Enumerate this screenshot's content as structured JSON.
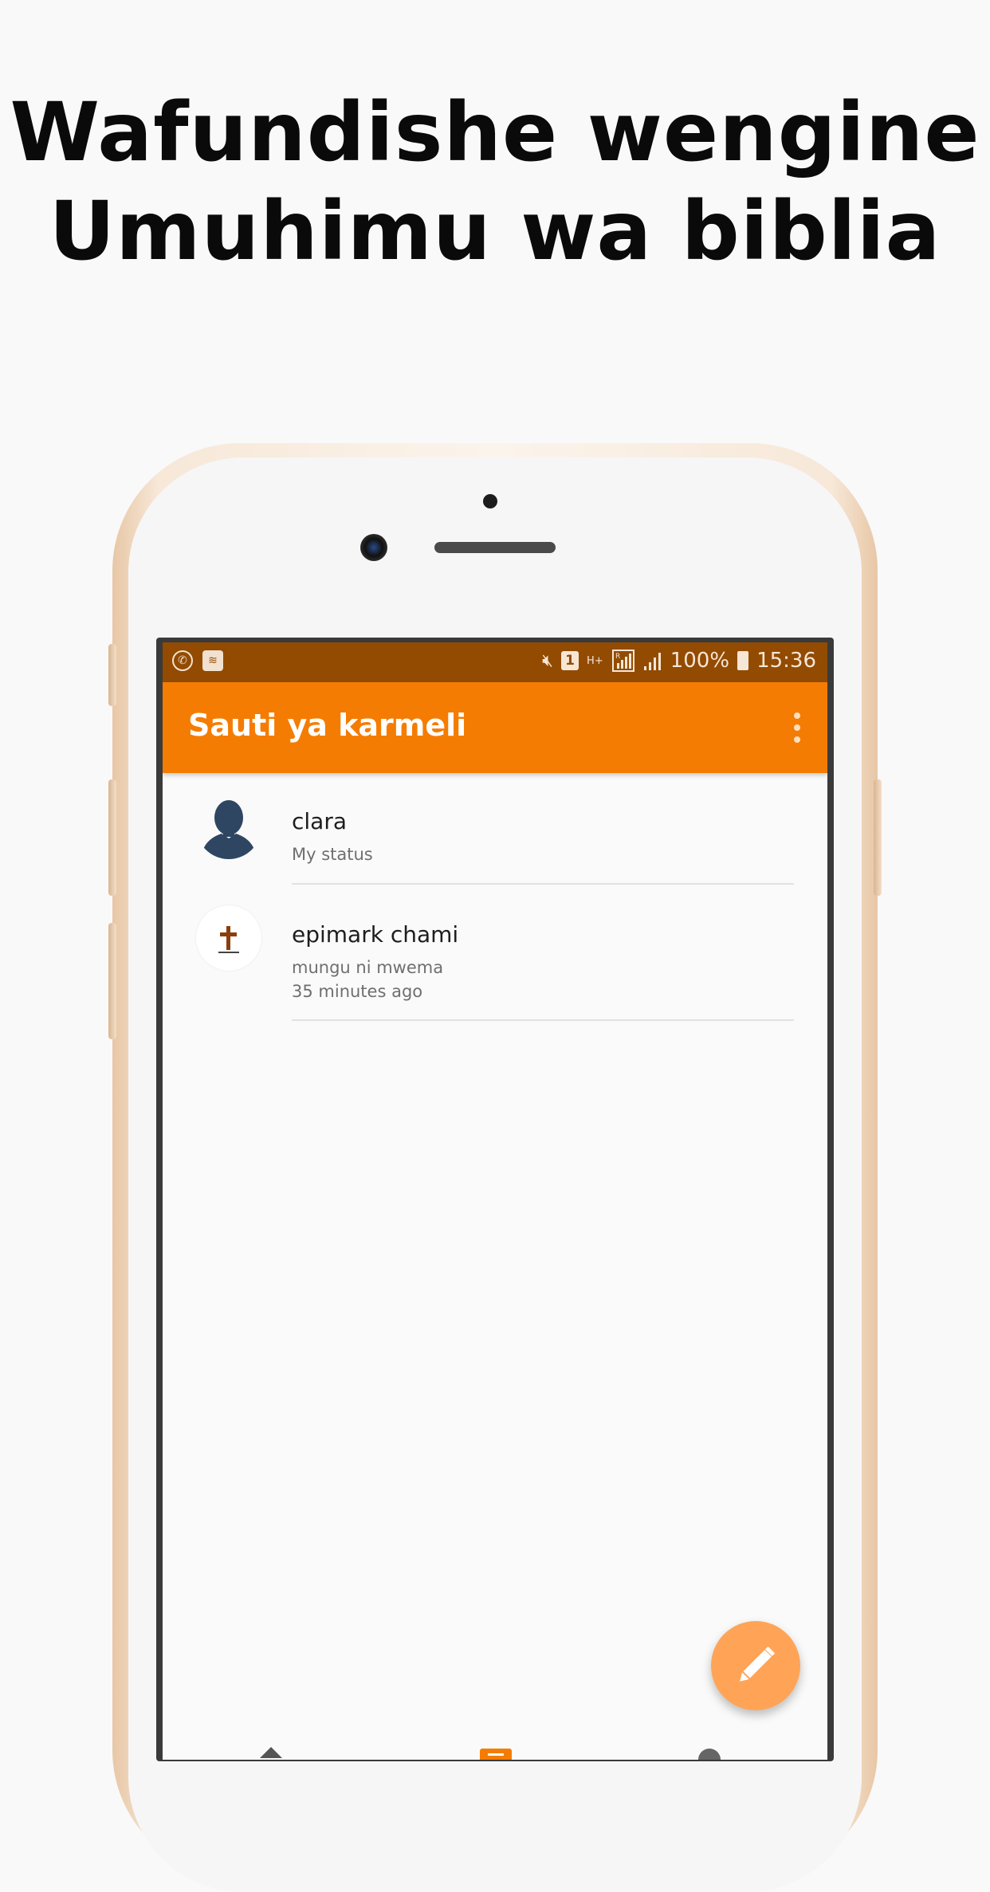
{
  "headline": {
    "line1": "Wafundishe wengine",
    "line2": "Umuhimu wa biblia"
  },
  "status_bar": {
    "battery_percent": "100%",
    "time": "15:36",
    "sim_label": "1",
    "network_top": "H+",
    "network_signal_label": "R"
  },
  "app_bar": {
    "title": "Sauti ya karmeli"
  },
  "contacts": [
    {
      "name": "clara",
      "status": "My status",
      "avatar_icon": "person-silhouette-icon"
    },
    {
      "name": "epimark chami",
      "status": "mungu ni mwema",
      "time_ago": "35 minutes ago",
      "avatar_icon": "cross-logo-icon"
    }
  ],
  "colors": {
    "status_bar": "#924b00",
    "app_bar": "#f57c02",
    "fab": "#ffa456",
    "background": "#f9f9fa"
  },
  "fab": {
    "icon": "pencil-icon"
  },
  "bottom_nav": {
    "icons": [
      "home-icon",
      "status-icon",
      "contact-icon"
    ]
  }
}
